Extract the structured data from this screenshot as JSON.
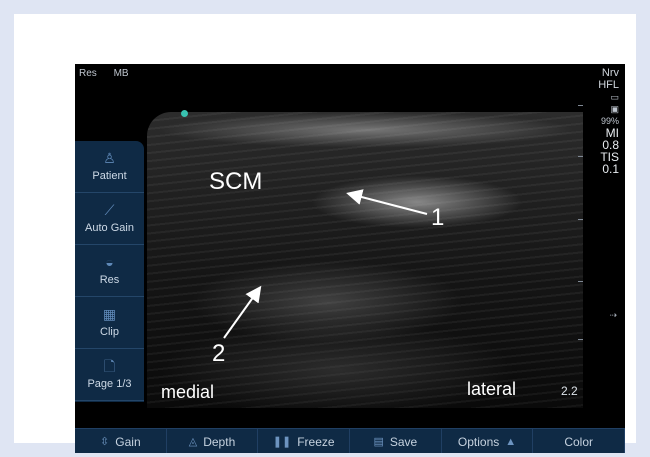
{
  "top_status": {
    "left_label": "Res",
    "right_label": "MB"
  },
  "right_status": {
    "mode": "Nrv",
    "probe": "HFL",
    "battery": "99%",
    "mi_label": "MI",
    "mi_value": "0.8",
    "tis_label": "TIS",
    "tis_value": "0.1"
  },
  "image_labels": {
    "muscle": "SCM",
    "marker_1": "1",
    "marker_2": "2",
    "left_side": "medial",
    "right_side": "lateral",
    "depth": "2.2"
  },
  "side_menu": [
    {
      "label": "Patient",
      "icon": "patient-icon"
    },
    {
      "label": "Auto Gain",
      "icon": "auto-gain-icon"
    },
    {
      "label": "Res",
      "icon": "resolution-icon"
    },
    {
      "label": "Clip",
      "icon": "clip-icon"
    },
    {
      "label": "Page 1/3",
      "icon": "page-icon"
    }
  ],
  "bottom_bar": [
    {
      "label": "Gain",
      "icon": "gain-icon"
    },
    {
      "label": "Depth",
      "icon": "depth-icon"
    },
    {
      "label": "Freeze",
      "icon": "pause-icon"
    },
    {
      "label": "Save",
      "icon": "save-icon"
    },
    {
      "label": "Options",
      "icon": "options-icon"
    },
    {
      "label": "Color",
      "icon": "color-icon"
    }
  ],
  "colors": {
    "panel": "#0f2a45",
    "accent": "#38c2b0",
    "background": "#000000"
  }
}
